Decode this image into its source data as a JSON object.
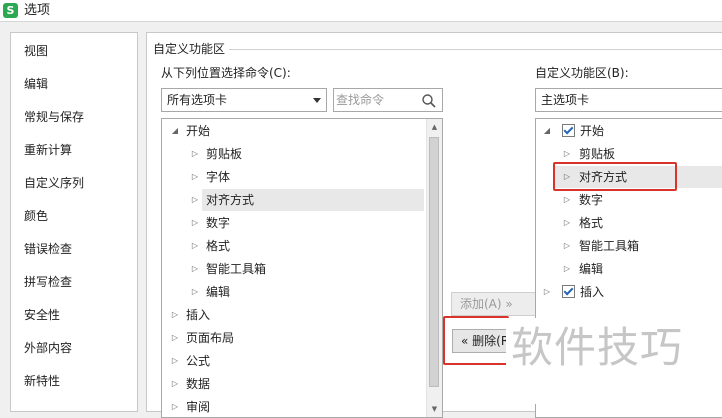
{
  "window": {
    "title": "选项",
    "logo_letter": "S"
  },
  "sidebar": {
    "items": [
      {
        "label": "视图"
      },
      {
        "label": "编辑"
      },
      {
        "label": "常规与保存"
      },
      {
        "label": "重新计算"
      },
      {
        "label": "自定义序列"
      },
      {
        "label": "颜色"
      },
      {
        "label": "错误检查"
      },
      {
        "label": "拼写检查"
      },
      {
        "label": "安全性"
      },
      {
        "label": "外部内容"
      },
      {
        "label": "新特性"
      }
    ]
  },
  "main": {
    "group_title": "自定义功能区",
    "left": {
      "label": "从下列位置选择命令(C):",
      "dropdown_value": "所有选项卡",
      "search_placeholder": "查找命令",
      "tree": [
        "开始",
        "剪贴板",
        "字体",
        "对齐方式",
        "数字",
        "格式",
        "智能工具箱",
        "编辑",
        "插入",
        "页面布局",
        "公式",
        "数据",
        "审阅"
      ]
    },
    "buttons": {
      "add": "添加(A) »",
      "remove": "« 删除(R)"
    },
    "right": {
      "label": "自定义功能区(B):",
      "dropdown_value": "主选项卡",
      "tree": [
        "开始",
        "剪贴板",
        "对齐方式",
        "数字",
        "格式",
        "智能工具箱",
        "编辑",
        "插入"
      ]
    }
  },
  "watermark": "软件技巧",
  "colors": {
    "highlight": "#d9342b",
    "logo": "#2aa952",
    "selection": "#e8e8e8"
  }
}
